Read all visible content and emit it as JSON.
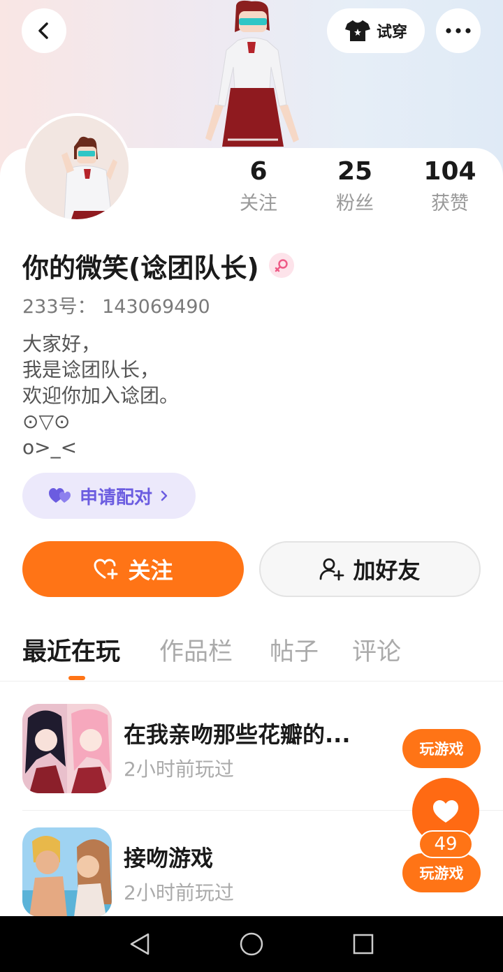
{
  "header": {
    "try_on_label": "试穿"
  },
  "stats": [
    {
      "value": "6",
      "label": "关注"
    },
    {
      "value": "25",
      "label": "粉丝"
    },
    {
      "value": "104",
      "label": "获赞"
    }
  ],
  "profile": {
    "name": "你的微笑(谂团队长)",
    "uid": "233号： 143069490",
    "bio": "大家好，\n我是谂团队长，\n欢迎你加入谂团。\n⊙▽⊙\no>_<"
  },
  "pair_button": {
    "label": "申请配对"
  },
  "actions": {
    "follow_label": "关注",
    "add_friend_label": "加好友"
  },
  "tabs": [
    {
      "label": "最近在玩",
      "active": true
    },
    {
      "label": "作品栏",
      "active": false
    },
    {
      "label": "帖子",
      "active": false
    },
    {
      "label": "评论",
      "active": false
    }
  ],
  "games": [
    {
      "title": "在我亲吻那些花瓣的...",
      "subtitle": "2小时前玩过",
      "play_label": "玩游戏"
    },
    {
      "title": "接吻游戏",
      "subtitle": "2小时前玩过",
      "play_label": "玩游戏"
    }
  ],
  "like_fab": {
    "count": "49"
  },
  "colors": {
    "accent": "#ff7416",
    "pair_purple": "#6b5ce0",
    "pair_bg": "#ece9fb"
  },
  "icons": {
    "back": "chevron-left-icon",
    "try_on": "tshirt-icon",
    "more": "more-dots-icon",
    "gender": "female-icon",
    "pair": "hearts-icon",
    "follow": "heart-plus-icon",
    "add_friend": "user-plus-icon",
    "like": "heart-icon"
  }
}
